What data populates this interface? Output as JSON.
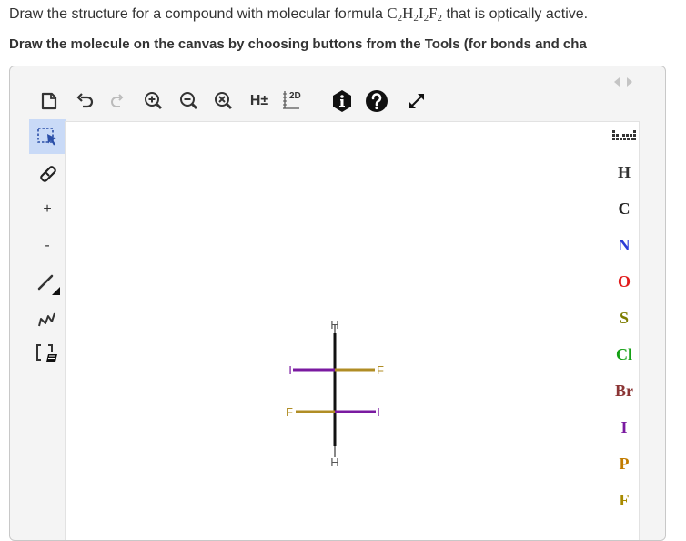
{
  "question": {
    "prefix": "Draw the structure for a compound with molecular formula ",
    "formula": [
      {
        "t": "C"
      },
      {
        "t": "2",
        "sub": true
      },
      {
        "t": "H"
      },
      {
        "t": "2",
        "sub": true
      },
      {
        "t": "I"
      },
      {
        "t": "2",
        "sub": true
      },
      {
        "t": "F"
      },
      {
        "t": "2",
        "sub": true
      }
    ],
    "suffix": " that is optically active."
  },
  "instruction": "Draw the molecule on the canvas by choosing buttons from the Tools (for bonds and cha",
  "toolbar": {
    "icons": [
      "document-icon",
      "undo-icon",
      "redo-icon",
      "zoom-in-icon",
      "zoom-out-icon",
      "clear-icon",
      "add-hydrogen-icon",
      "2d-clean-icon",
      "info-icon",
      "help-icon",
      "fullscreen-icon"
    ],
    "hpm_label": "H±",
    "clean_label": "2D"
  },
  "left_tools": {
    "icons": [
      "select-icon",
      "eraser-icon",
      "charge-plus-icon",
      "charge-minus-icon",
      "bond-icon",
      "chain-icon",
      "bracket-icon"
    ],
    "plus_label": "+",
    "minus_label": "-",
    "selected": "select-icon"
  },
  "elements": [
    {
      "symbol": "H",
      "color": "#333333"
    },
    {
      "symbol": "C",
      "color": "#222222"
    },
    {
      "symbol": "N",
      "color": "#2c3bd6"
    },
    {
      "symbol": "O",
      "color": "#e21b1b"
    },
    {
      "symbol": "S",
      "color": "#7d7d00"
    },
    {
      "symbol": "Cl",
      "color": "#15a015"
    },
    {
      "symbol": "Br",
      "color": "#8b3535"
    },
    {
      "symbol": "I",
      "color": "#7a1aa0"
    },
    {
      "symbol": "P",
      "color": "#c27c00"
    },
    {
      "symbol": "F",
      "color": "#a88a00"
    }
  ],
  "molecule": {
    "atoms": {
      "top_h": "H",
      "left_i": "I",
      "right_f": "F",
      "left_f": "F",
      "right_i": "I",
      "bottom_h": "H"
    },
    "colors": {
      "I": "#7a1aa0",
      "F": "#b08d25",
      "H": "#555555",
      "bond": "#111111"
    }
  }
}
